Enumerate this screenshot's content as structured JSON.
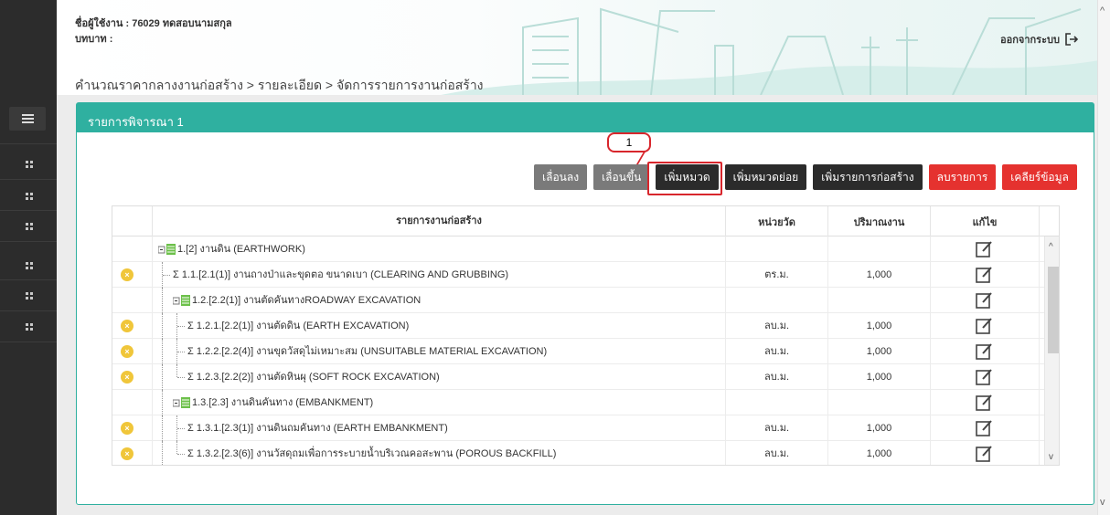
{
  "header": {
    "user_label": "ชื่อผู้ใช้งาน : 76029 ทดสอบนามสกุล",
    "role_label": "บทบาท :",
    "breadcrumb": "คำนวณราคากลางงานก่อสร้าง > รายละเอียด > จัดการรายการงานก่อสร้าง",
    "logout_label": "ออกจากระบบ"
  },
  "panel": {
    "title": "รายการพิจารณา 1"
  },
  "callout": {
    "number": "1"
  },
  "toolbar": {
    "move_down": "เลื่อนลง",
    "move_up": "เลื่อนขึ้น",
    "add_category": "เพิ่มหมวด",
    "add_subcategory": "เพิ่มหมวดย่อย",
    "add_item": "เพิ่มรายการก่อสร้าง",
    "delete_item": "ลบรายการ",
    "clear_data": "เคลียร์ข้อมูล"
  },
  "table": {
    "headers": {
      "name": "รายการงานก่อสร้าง",
      "unit": "หน่วยวัด",
      "quantity": "ปริมาณงาน",
      "edit": "แก้ไข"
    },
    "rows": [
      {
        "name": "1.[2] งานดิน (EARTHWORK)",
        "unit": "",
        "quantity": ""
      },
      {
        "name": "Σ 1.1.[2.1(1)] งานถางป่าและขุดตอ ขนาดเบา (CLEARING AND GRUBBING)",
        "unit": "ตร.ม.",
        "quantity": "1,000"
      },
      {
        "name": "1.2.[2.2(1)] งานตัดคันทางROADWAY EXCAVATION",
        "unit": "",
        "quantity": ""
      },
      {
        "name": "Σ 1.2.1.[2.2(1)] งานตัดดิน (EARTH EXCAVATION)",
        "unit": "ลบ.ม.",
        "quantity": "1,000"
      },
      {
        "name": "Σ 1.2.2.[2.2(4)] งานขุดวัสดุไม่เหมาะสม (UNSUITABLE MATERIAL EXCAVATION)",
        "unit": "ลบ.ม.",
        "quantity": "1,000"
      },
      {
        "name": "Σ 1.2.3.[2.2(2)] งานตัดหินผุ (SOFT ROCK EXCAVATION)",
        "unit": "ลบ.ม.",
        "quantity": "1,000"
      },
      {
        "name": "1.3.[2.3] งานดินคันทาง (EMBANKMENT)",
        "unit": "",
        "quantity": ""
      },
      {
        "name": "Σ 1.3.1.[2.3(1)] งานดินถมคันทาง (EARTH EMBANKMENT)",
        "unit": "ลบ.ม.",
        "quantity": "1,000"
      },
      {
        "name": "Σ 1.3.2.[2.3(6)] งานวัสดุถมเพื่อการระบายน้ำบริเวณคอสะพาน (POROUS BACKFILL)",
        "unit": "ลบ.ม.",
        "quantity": "1,000"
      }
    ]
  },
  "colors": {
    "accent": "#2fb0a0",
    "danger": "#e5322f",
    "dark": "#2b2b2b",
    "sidebar": "#2c2c2c",
    "delete_dot": "#f0c63a",
    "highlight": "#d8262c"
  }
}
